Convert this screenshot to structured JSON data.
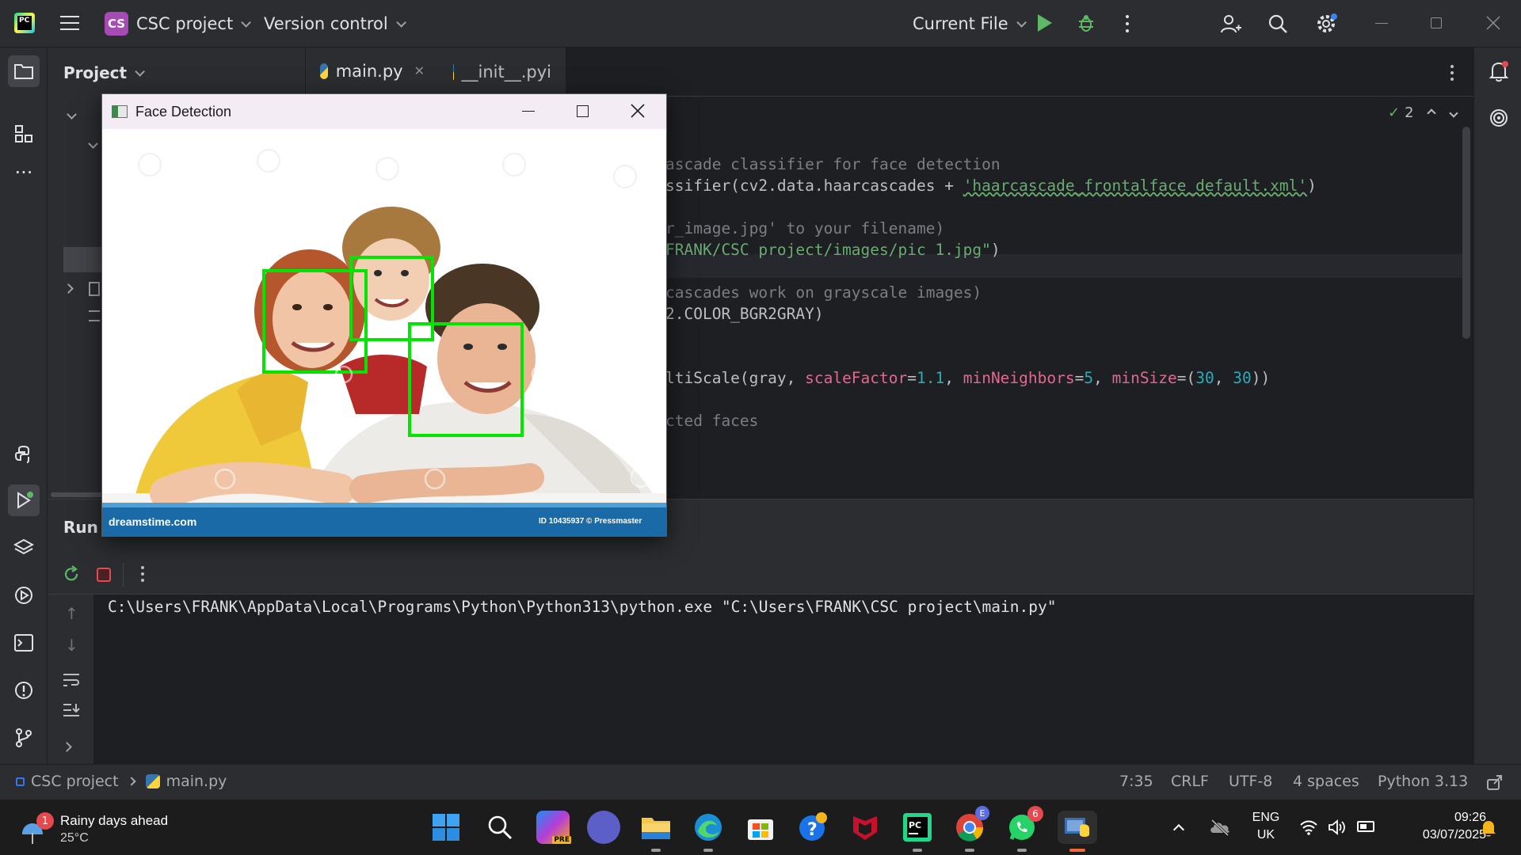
{
  "titlebar": {
    "project_badge": "CS",
    "project_name": "CSC project",
    "vcs": "Version control",
    "run_config": "Current File"
  },
  "project_panel": {
    "title": "Project"
  },
  "editor": {
    "tabs": [
      {
        "label": "main.py",
        "active": true
      },
      {
        "label": "__init__.pyi",
        "active": false
      }
    ],
    "inspection_count": "2",
    "lines": {
      "l1": "ascade classifier for face detection",
      "l2a": "ssifier(cv2.data.haarcascades + ",
      "l2b": "'haarcascade_frontalface_default.xml'",
      "l2c": ")",
      "l3": "r_image.jpg' to your filename)",
      "l4a": "FRANK/CSC project/images/pic 1.jpg\"",
      "l4b": ")",
      "l5": "cascades work on grayscale images)",
      "l6": "2.COLOR_BGR2GRAY)",
      "l7a": "ltiScale(gray, ",
      "l7b": "scaleFactor",
      "l7c": "=",
      "l7d": "1.1",
      "l7e": ", ",
      "l7f": "minNeighbors",
      "l7g": "=",
      "l7h": "5",
      "l7i": ", ",
      "l7j": "minSize",
      "l7k": "=(",
      "l7l": "30",
      "l7m": ", ",
      "l7n": "30",
      "l7o": "))",
      "l8": "cted faces"
    }
  },
  "run_panel": {
    "title": "Run",
    "output": "C:\\Users\\FRANK\\AppData\\Local\\Programs\\Python\\Python313\\python.exe \"C:\\Users\\FRANK\\CSC project\\main.py\""
  },
  "face_window": {
    "title": "Face Detection",
    "watermark_left": "dreamstime.com",
    "watermark_right": "ID 10435937 © Pressmaster",
    "box_color": "#00e600"
  },
  "statusbar": {
    "crumb_project": "CSC project",
    "crumb_file": "main.py",
    "position": "7:35",
    "line_sep": "CRLF",
    "encoding": "UTF-8",
    "indent": "4 spaces",
    "interpreter": "Python 3.13"
  },
  "taskbar": {
    "weather_badge": "1",
    "weather_title": "Rainy days ahead",
    "weather_temp": "25°C",
    "lang": "ENG",
    "region": "UK",
    "time": "09:26",
    "date": "03/07/2025",
    "chrome_badge": "E",
    "whatsapp_badge": "6",
    "copilot_label": "PRE"
  }
}
